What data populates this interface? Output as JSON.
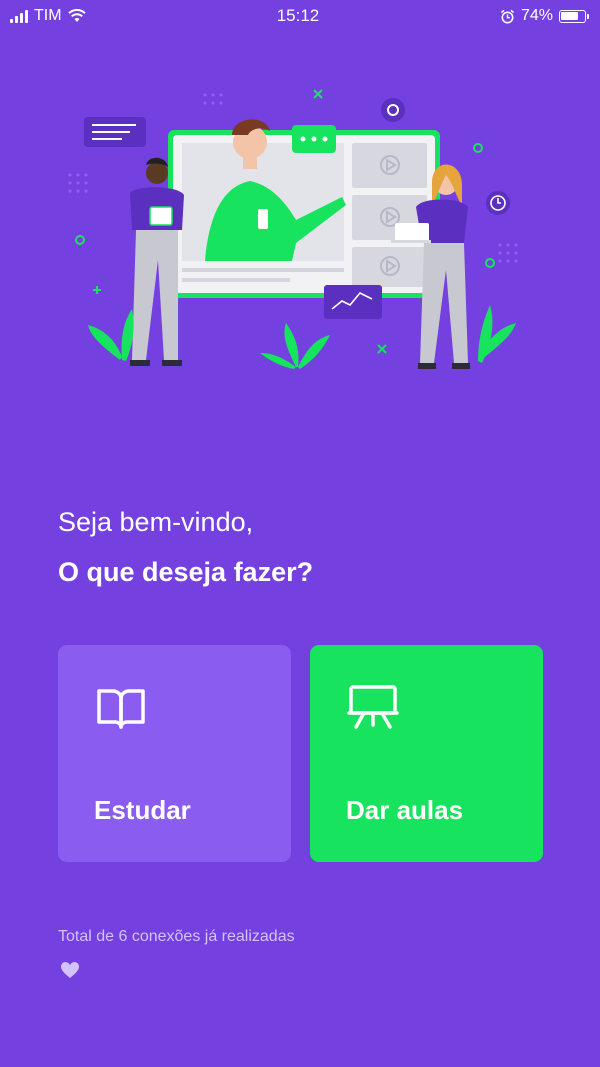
{
  "status_bar": {
    "carrier": "TIM",
    "time": "15:12",
    "battery_percent": "74%",
    "battery_level": 0.74,
    "icons": [
      "signal-icon",
      "wifi-icon",
      "alarm-icon",
      "battery-icon"
    ]
  },
  "illustration": {
    "icon": "online-classroom-illustration"
  },
  "greeting": {
    "line1": "Seja bem-vindo,",
    "line2": "O que deseja fazer?"
  },
  "actions": {
    "study": {
      "label": "Estudar",
      "icon": "book-icon",
      "color": "#8B5CF0"
    },
    "teach": {
      "label": "Dar aulas",
      "icon": "presentation-icon",
      "color": "#17E35E"
    }
  },
  "footer": {
    "connections_text": "Total de 6 conexões já realizadas",
    "icon": "heart-icon"
  },
  "colors": {
    "background": "#7440E0",
    "accent_green": "#17E35E",
    "muted_text": "#D4C2FF"
  }
}
